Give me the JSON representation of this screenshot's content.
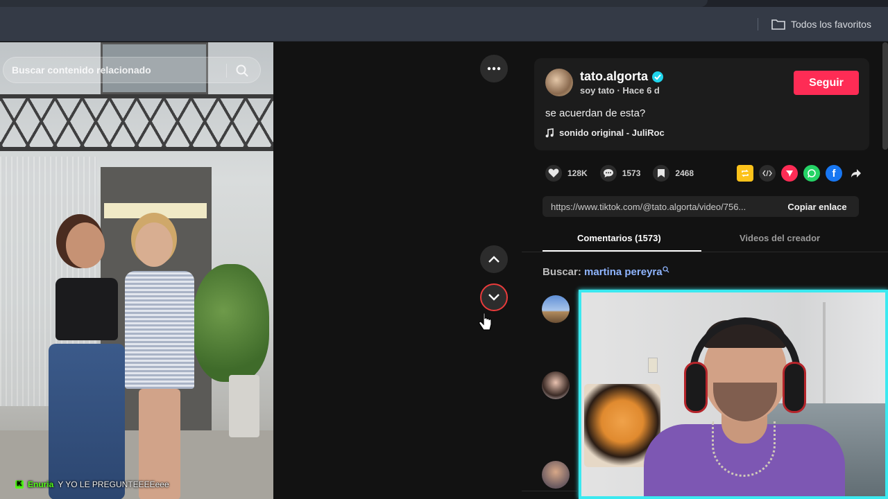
{
  "browser": {
    "bookmarks_folder_label": "Todos los favoritos",
    "bookmarks_folder_icon": "folder-icon"
  },
  "video": {
    "search_placeholder": "Buscar contenido relacionado",
    "search_icon": "search-icon",
    "chat_overlay": {
      "badge": "K",
      "user": "Enuria",
      "message": "Y YO LE PREGUNTEEEEeee"
    }
  },
  "navigation": {
    "more_icon": "more-horizontal-icon",
    "up_icon": "chevron-up-icon",
    "down_icon": "chevron-down-icon"
  },
  "author": {
    "username": "tato.algorta",
    "verified": true,
    "subline": "soy tato · Hace 6 d",
    "follow_label": "Seguir",
    "caption": "se acuerdan de esta?",
    "sound": "sonido original - JuliRoc"
  },
  "stats": {
    "likes": "128K",
    "comments": "1573",
    "saves": "2468"
  },
  "share": {
    "link": "https://www.tiktok.com/@tato.algorta/video/756...",
    "copy_label": "Copiar enlace"
  },
  "tabs": {
    "comments": "Comentarios (1573)",
    "creator_videos": "Videos del creador"
  },
  "search_suggestion": {
    "prefix": "Buscar:",
    "term": "martina pereyra"
  },
  "colors": {
    "follow": "#fe2c55",
    "webcam_border": "#3be9f0",
    "verified": "#20d5ec",
    "chat_user": "#53fc18"
  }
}
